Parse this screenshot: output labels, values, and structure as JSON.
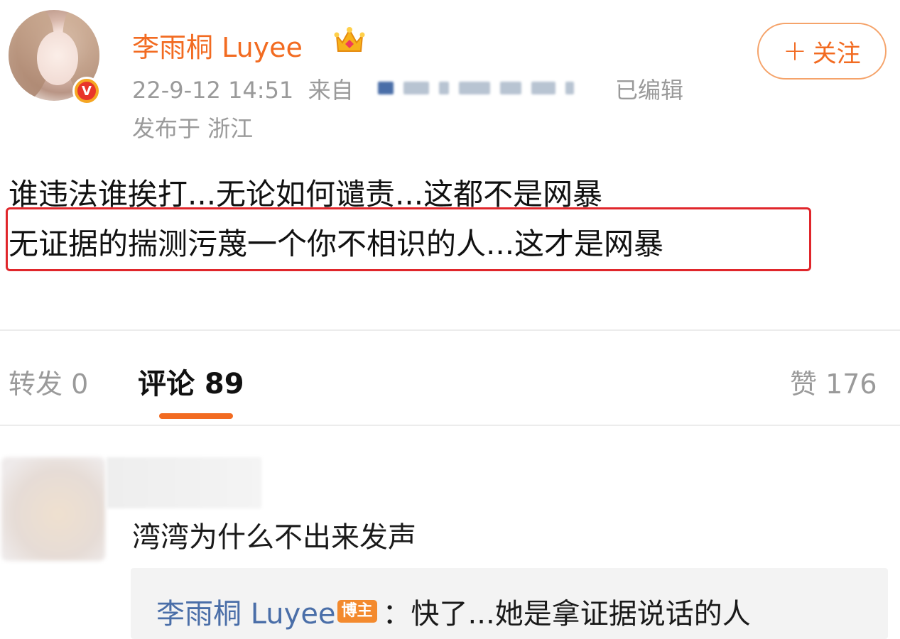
{
  "post": {
    "author": "李雨桐 Luyee",
    "follow_label": "关注",
    "follow_plus": "+",
    "timestamp": "22-9-12 14:51",
    "source_prefix": "来自",
    "edited": "已编辑",
    "location": "发布于 浙江",
    "lines": [
      "谁违法谁挨打...无论如何谴责...这都不是网暴",
      "无证据的揣测污蔑一个你不相识的人...这才是网暴"
    ]
  },
  "tabs": {
    "repost": "转发 0",
    "comment": "评论 89",
    "like": "赞 176"
  },
  "comment": {
    "text": "湾湾为什么不出来发声",
    "reply": {
      "author": "李雨桐 Luyee",
      "tag": "博主",
      "text": "：快了...她是拿证据说话的人"
    }
  },
  "colors": {
    "accent": "#f26b21",
    "highlight_border": "#e0262b",
    "reply_author": "#4a6ea8",
    "muted": "#9a9a9a"
  },
  "icons": [
    "verified-v-icon",
    "crown-icon",
    "plus-icon"
  ]
}
